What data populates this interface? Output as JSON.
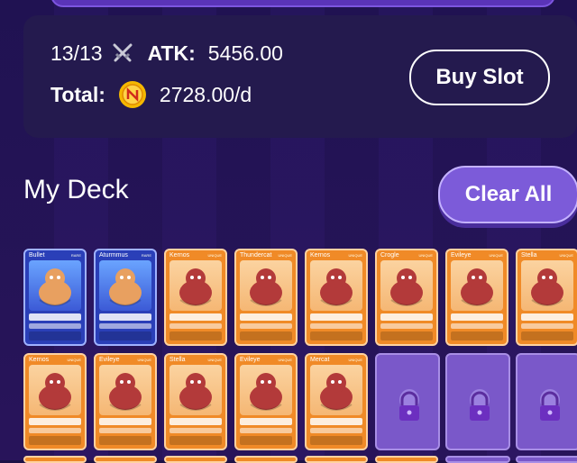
{
  "stats": {
    "slots": "13/13",
    "atk_label": "ATK:",
    "atk_value": "5456.00",
    "total_label": "Total:",
    "total_value": "2728.00/d"
  },
  "buttons": {
    "buy_slot": "Buy Slot",
    "clear_all": "Clear All"
  },
  "deck": {
    "title": "My Deck",
    "cards": [
      {
        "name": "Bullet",
        "tag": "RARE",
        "style": "blue"
      },
      {
        "name": "Aturmmus",
        "tag": "RARE",
        "style": "blue"
      },
      {
        "name": "Kernos",
        "tag": "UNIQUE",
        "style": "orange"
      },
      {
        "name": "Thundercat",
        "tag": "UNIQUE",
        "style": "orange"
      },
      {
        "name": "Kernos",
        "tag": "UNIQUE",
        "style": "orange"
      },
      {
        "name": "Crogle",
        "tag": "UNIQUE",
        "style": "orange"
      },
      {
        "name": "Evileye",
        "tag": "UNIQUE",
        "style": "orange"
      },
      {
        "name": "Stella",
        "tag": "UNIQUE",
        "style": "orange"
      },
      {
        "name": "Kernos",
        "tag": "UNIQUE",
        "style": "orange"
      },
      {
        "name": "Evileye",
        "tag": "UNIQUE",
        "style": "orange"
      },
      {
        "name": "Stella",
        "tag": "UNIQUE",
        "style": "orange"
      },
      {
        "name": "Evileye",
        "tag": "UNIQUE",
        "style": "orange"
      },
      {
        "name": "Mercat",
        "tag": "UNIQUE",
        "style": "orange"
      },
      {
        "name": "",
        "tag": "",
        "style": "locked"
      },
      {
        "name": "",
        "tag": "",
        "style": "locked"
      },
      {
        "name": "",
        "tag": "",
        "style": "locked"
      }
    ]
  },
  "icons": {
    "swords": "crossed-swords-icon",
    "coin": "coin-icon",
    "lock": "lock-icon"
  },
  "colors": {
    "accent": "#7c5bd9",
    "card_orange": "#f08a27",
    "card_blue": "#2a3fb8",
    "locked": "#7a58c9",
    "coin": "#f5b800"
  }
}
